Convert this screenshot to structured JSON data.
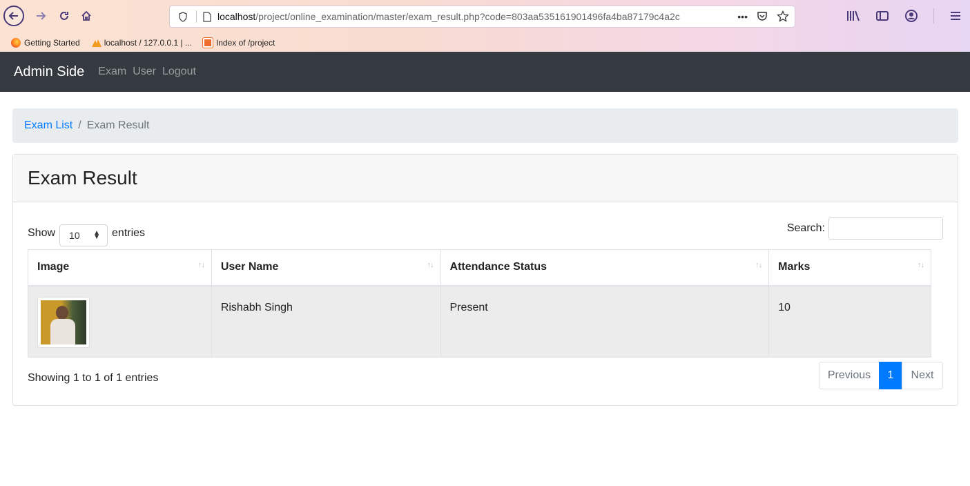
{
  "browser": {
    "url_host": "localhost",
    "url_path": "/project/online_examination/master/exam_result.php?code=803aa535161901496fa4ba87179c4a2c",
    "url_more": "•••",
    "bookmarks": [
      {
        "label": "Getting Started",
        "icon": "firefox-icon"
      },
      {
        "label": "localhost / 127.0.0.1 | ...",
        "icon": "phpmyadmin-icon"
      },
      {
        "label": "Index of /project",
        "icon": "folder-icon"
      }
    ]
  },
  "navbar": {
    "brand": "Admin Side",
    "links": [
      "Exam",
      "User",
      "Logout"
    ]
  },
  "breadcrumb": {
    "link": "Exam List",
    "separator": "/",
    "active": "Exam Result"
  },
  "card": {
    "title": "Exam Result"
  },
  "table_controls": {
    "show_label": "Show",
    "entries_value": "10",
    "entries_label": "entries",
    "search_label": "Search:"
  },
  "table": {
    "columns": [
      "Image",
      "User Name",
      "Attendance Status",
      "Marks"
    ],
    "rows": [
      {
        "user_name": "Rishabh Singh",
        "attendance": "Present",
        "marks": "10"
      }
    ]
  },
  "footer": {
    "info": "Showing 1 to 1 of 1 entries",
    "previous": "Previous",
    "current_page": "1",
    "next": "Next"
  },
  "colors": {
    "navbar": "#343a40",
    "link": "#007bff",
    "page_active": "#007bff"
  }
}
